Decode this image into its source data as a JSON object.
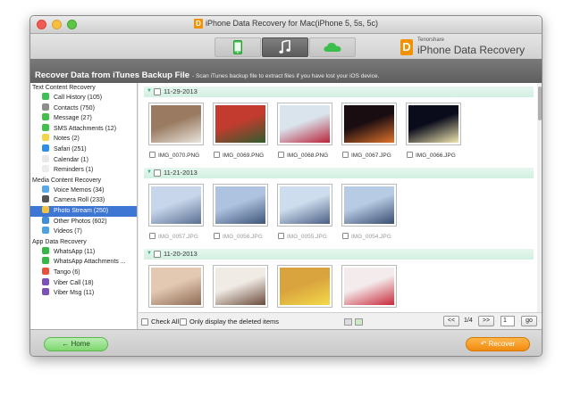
{
  "window": {
    "title": "iPhone Data Recovery for Mac(iPhone 5, 5s, 5c)",
    "title_logo": "D"
  },
  "toolbar": {
    "tabs": [
      {
        "name": "device",
        "icon": "iphone-icon"
      },
      {
        "name": "itunes",
        "icon": "music-note-icon",
        "selected": true
      },
      {
        "name": "icloud",
        "icon": "cloud-icon"
      }
    ],
    "brand_small": "Tenorshare",
    "brand_main": "iPhone Data Recovery",
    "brand_logo": "D"
  },
  "banner": {
    "title": "Recover Data from iTunes Backup File",
    "subtitle": "- Scan iTunes backup file to extract files if you have lost your iOS device."
  },
  "sidebar": {
    "sections": [
      {
        "title": "Text Content Recovery",
        "items": [
          {
            "label": "Call History (105)",
            "icon": "phone-icon",
            "color": "#3fbf55"
          },
          {
            "label": "Contacts (750)",
            "icon": "contacts-icon",
            "color": "#8e8e8e"
          },
          {
            "label": "Message (27)",
            "icon": "message-icon",
            "color": "#41c04a"
          },
          {
            "label": "SMS Attachments (12)",
            "icon": "sms-attachment-icon",
            "color": "#41c04a"
          },
          {
            "label": "Notes (2)",
            "icon": "notes-icon",
            "color": "#f2d54b"
          },
          {
            "label": "Safari (251)",
            "icon": "safari-icon",
            "color": "#2d8ee8"
          },
          {
            "label": "Calendar (1)",
            "icon": "calendar-icon",
            "color": "#e8e8e8"
          },
          {
            "label": "Reminders (1)",
            "icon": "reminders-icon",
            "color": "#ececec"
          }
        ]
      },
      {
        "title": "Media Content Recovery",
        "items": [
          {
            "label": "Voice Memos (34)",
            "icon": "voice-memo-icon",
            "color": "#58a8e8"
          },
          {
            "label": "Camera Roll (233)",
            "icon": "camera-roll-icon",
            "color": "#555555"
          },
          {
            "label": "Photo Stream (250)",
            "icon": "photo-stream-icon",
            "color": "#f5c242",
            "selected": true
          },
          {
            "label": "Other Photos (602)",
            "icon": "photos-icon",
            "color": "#3d8fd9"
          },
          {
            "label": "Videos (7)",
            "icon": "videos-icon",
            "color": "#4aa2e0"
          }
        ]
      },
      {
        "title": "App Data Recovery",
        "items": [
          {
            "label": "WhatsApp (11)",
            "icon": "whatsapp-icon",
            "color": "#35b845"
          },
          {
            "label": "WhatsApp Attachments ...",
            "icon": "whatsapp-attachment-icon",
            "color": "#35b845"
          },
          {
            "label": "Tango (6)",
            "icon": "tango-icon",
            "color": "#e8503a"
          },
          {
            "label": "Viber Call (18)",
            "icon": "viber-call-icon",
            "color": "#7d4fb9"
          },
          {
            "label": "Viber Msg (11)",
            "icon": "viber-msg-icon",
            "color": "#7d4fb9"
          }
        ]
      }
    ]
  },
  "groups": [
    {
      "date": "11-29-2013",
      "items": [
        {
          "name": "IMG_0070.PNG",
          "deleted": false,
          "colors": [
            "#9a7b62",
            "#e9e4dc"
          ]
        },
        {
          "name": "IMG_0069.PNG",
          "deleted": false,
          "colors": [
            "#c33b2e",
            "#2f5d2e"
          ]
        },
        {
          "name": "IMG_0068.PNG",
          "deleted": false,
          "colors": [
            "#d9e4ec",
            "#b9233a"
          ]
        },
        {
          "name": "IMG_0067.JPG",
          "deleted": false,
          "colors": [
            "#1a0d12",
            "#e0732a"
          ]
        },
        {
          "name": "IMG_0066.JPG",
          "deleted": false,
          "colors": [
            "#0a0c1c",
            "#f0e6b0"
          ]
        }
      ]
    },
    {
      "date": "11-21-2013",
      "items": [
        {
          "name": "IMG_0057.JPG",
          "deleted": true,
          "colors": [
            "#c7d6ea",
            "#5a6f92"
          ]
        },
        {
          "name": "IMG_0056.JPG",
          "deleted": true,
          "colors": [
            "#aec3df",
            "#3f5579"
          ]
        },
        {
          "name": "IMG_0055.JPG",
          "deleted": true,
          "colors": [
            "#cdddee",
            "#4b5f84"
          ]
        },
        {
          "name": "IMG_0054.JPG",
          "deleted": true,
          "colors": [
            "#b7cbe4",
            "#3a4d70"
          ]
        }
      ]
    },
    {
      "date": "11-20-2013",
      "items": [
        {
          "name": "",
          "deleted": false,
          "colors": [
            "#e3c9b1",
            "#8e6a55"
          ]
        },
        {
          "name": "",
          "deleted": false,
          "colors": [
            "#f1ebe5",
            "#6a4a3a"
          ]
        },
        {
          "name": "",
          "deleted": false,
          "colors": [
            "#d9a33d",
            "#f3d94a"
          ]
        },
        {
          "name": "",
          "deleted": false,
          "colors": [
            "#f4ecec",
            "#c8283a"
          ]
        }
      ]
    }
  ],
  "bottom": {
    "check_all": "Check All",
    "only_deleted": "Only display the deleted items",
    "prev": "<<",
    "page_info": "1/4",
    "next": ">>",
    "page_input": "1",
    "go": "go"
  },
  "footer": {
    "home": "Home",
    "recover": "Recover"
  },
  "colors": {
    "selection": "#3e76d3",
    "date_bar": "#d2f0e1",
    "home_button": "#7ed66f",
    "recover_button": "#f18a0f"
  }
}
